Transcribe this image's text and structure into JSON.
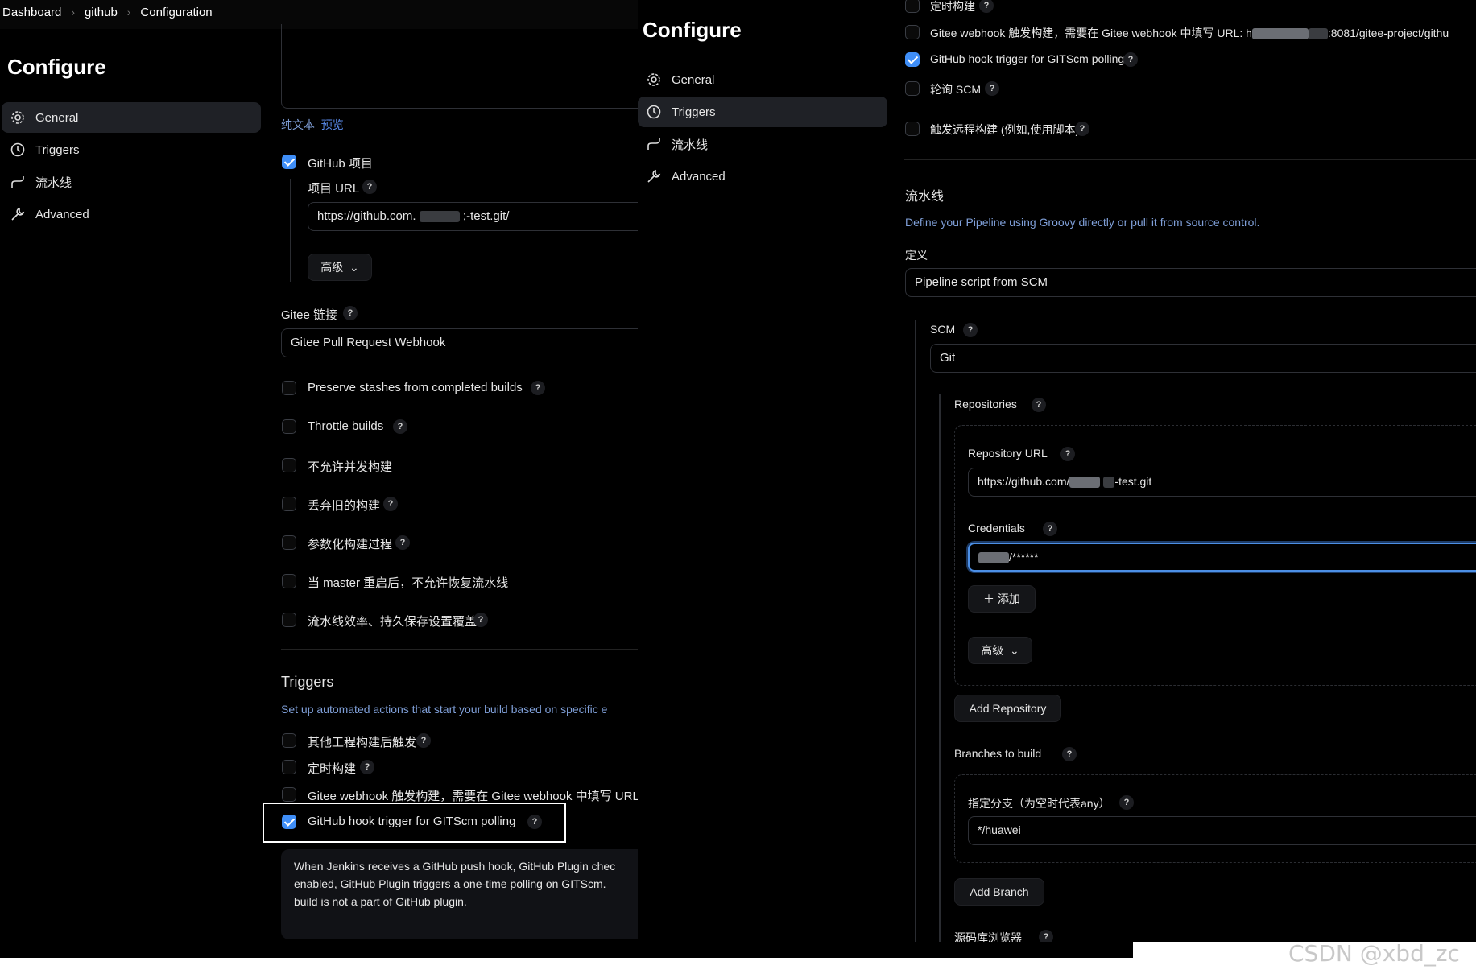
{
  "left": {
    "breadcrumb": [
      "Dashboard",
      "github",
      "Configuration"
    ],
    "title": "Configure",
    "nav": [
      {
        "label": "General",
        "icon": "gear-icon"
      },
      {
        "label": "Triggers",
        "icon": "clock-icon"
      },
      {
        "label": "流水线",
        "icon": "pipeline-icon"
      },
      {
        "label": "Advanced",
        "icon": "wrench-icon"
      }
    ],
    "editor_tabs": {
      "plain": "纯文本",
      "preview": "预览"
    },
    "github_project": {
      "label": "GitHub 项目",
      "checked": true
    },
    "project_url": {
      "label": "项目 URL",
      "value_prefix": "https://github.com.",
      "value_suffix": ";-test.git/"
    },
    "advanced_label": "高级",
    "gitee_link": {
      "label": "Gitee 链接",
      "value": "Gitee Pull Request Webhook"
    },
    "options": [
      {
        "label": "Preserve stashes from completed builds",
        "help": true
      },
      {
        "label": "Throttle builds",
        "help": true
      },
      {
        "label": "不允许并发构建",
        "help": false
      },
      {
        "label": "丢弃旧的构建",
        "help": true
      },
      {
        "label": "参数化构建过程",
        "help": true
      },
      {
        "label": "当 master 重启后，不允许恢复流水线",
        "help": false
      },
      {
        "label": "流水线效率、持久保存设置覆盖",
        "help": true
      }
    ],
    "triggers": {
      "title": "Triggers",
      "description": "Set up automated actions that start your build based on specific e",
      "items": [
        {
          "label": "其他工程构建后触发",
          "help": true,
          "checked": false
        },
        {
          "label": "定时构建",
          "help": true,
          "checked": false
        },
        {
          "label": "Gitee webhook 触发构建，需要在 Gitee webhook 中填写 URL:",
          "help": false,
          "checked": false
        },
        {
          "label": "GitHub hook trigger for GITScm polling",
          "help": true,
          "checked": true
        }
      ],
      "help_text": [
        "When Jenkins receives a GitHub push hook, GitHub Plugin chec",
        "enabled, GitHub Plugin triggers a one-time polling on GITScm.",
        "build is not a part of GitHub plugin."
      ]
    }
  },
  "right": {
    "title": "Configure",
    "nav": [
      {
        "label": "General",
        "icon": "gear-icon"
      },
      {
        "label": "Triggers",
        "icon": "clock-icon"
      },
      {
        "label": "流水线",
        "icon": "pipeline-icon"
      },
      {
        "label": "Advanced",
        "icon": "wrench-icon"
      }
    ],
    "trigger_items": [
      {
        "label": "定时构建",
        "help": true,
        "checked": false
      },
      {
        "label": "Gitee webhook 触发构建，需要在 Gitee webhook 中填写 URL: h",
        "url_tail": ":8081/gitee-project/githu",
        "help": false,
        "checked": false
      },
      {
        "label": "GitHub hook trigger for GITScm polling",
        "help": true,
        "checked": true
      },
      {
        "label": "轮询 SCM",
        "help": true,
        "checked": false
      },
      {
        "label": "触发远程构建 (例如,使用脚本)",
        "help": true,
        "checked": false
      }
    ],
    "pipeline": {
      "title": "流水线",
      "description": "Define your Pipeline using Groovy directly or pull it from source control.",
      "definition_label": "定义",
      "definition_value": "Pipeline script from SCM",
      "scm_label": "SCM",
      "scm_value": "Git",
      "repositories_label": "Repositories",
      "repo_url_label": "Repository URL",
      "repo_url_prefix": "https://github.com/",
      "repo_url_suffix": "-test.git",
      "credentials_label": "Credentials",
      "credentials_value": "/******",
      "add_label": "添加",
      "advanced_label": "高级",
      "add_repository": "Add Repository",
      "branches_label": "Branches to build",
      "branch_spec_label": "指定分支（为空时代表any）",
      "branch_value": "*/huawei",
      "add_branch": "Add Branch",
      "browser_label": "源码库浏览器"
    }
  },
  "watermark": "CSDN @xbd_zc",
  "colors": {
    "accent": "#3f8ef7",
    "background": "#000000",
    "link": "#5b8dee",
    "description": "#7f9fd8"
  }
}
